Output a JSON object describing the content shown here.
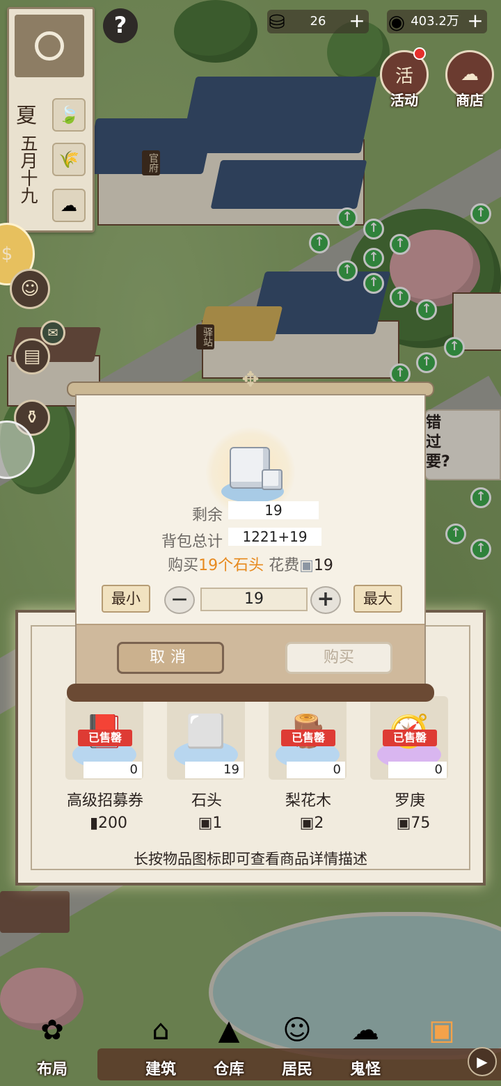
{
  "hud": {
    "season": "夏",
    "date": "五月十九",
    "help_symbol": "?",
    "resources": [
      {
        "icon": "silver-ingot-icon",
        "value": "26",
        "plus": "+"
      },
      {
        "icon": "copper-coin-icon",
        "value": "403.2万",
        "plus": "+"
      }
    ],
    "activity_label": "活动",
    "activity_glyph": "活",
    "shop_label": "商店"
  },
  "map": {
    "tag_office": "官府",
    "tag_station": "驿站",
    "side_card_text": "错过要?"
  },
  "dialog": {
    "remaining_label": "剩余",
    "remaining_value": "19",
    "bag_total_label": "背包总计",
    "bag_total_value": "1221+19",
    "buy_prefix": "购买",
    "buy_qty": "19个",
    "buy_item": "石头",
    "buy_cost_label": "花费",
    "buy_cost_value": "19",
    "min_label": "最小",
    "max_label": "最大",
    "quantity": "19",
    "minus_symbol": "—",
    "plus_symbol": "+",
    "cancel_label": "取消",
    "buy_label": "购买"
  },
  "shop": {
    "items": [
      {
        "name": "高级招募券",
        "count": "0",
        "price": "200",
        "sold": "已售罄",
        "icon": "recruit-ticket-icon"
      },
      {
        "name": "石头",
        "count": "19",
        "price": "1",
        "sold": "",
        "icon": "stone-icon"
      },
      {
        "name": "梨花木",
        "count": "0",
        "price": "2",
        "sold": "已售罄",
        "icon": "pear-wood-icon"
      },
      {
        "name": "罗庚",
        "count": "0",
        "price": "75",
        "sold": "已售罄",
        "icon": "compass-icon"
      }
    ],
    "tip": "长按物品图标即可查看商品详情描述"
  },
  "nav": {
    "items": [
      {
        "label": "布局",
        "icon": "layout-icon"
      },
      {
        "label": "建筑",
        "icon": "building-icon"
      },
      {
        "label": "仓库",
        "icon": "warehouse-icon"
      },
      {
        "label": "居民",
        "icon": "residents-icon"
      },
      {
        "label": "鬼怪",
        "icon": "ghost-icon"
      }
    ],
    "play_symbol": "▶"
  },
  "colors": {
    "accent_orange": "#e78a1f",
    "sold_red": "#de3b34",
    "grow_green": "#3fae4f",
    "panel_bg": "#f6f1e6"
  }
}
